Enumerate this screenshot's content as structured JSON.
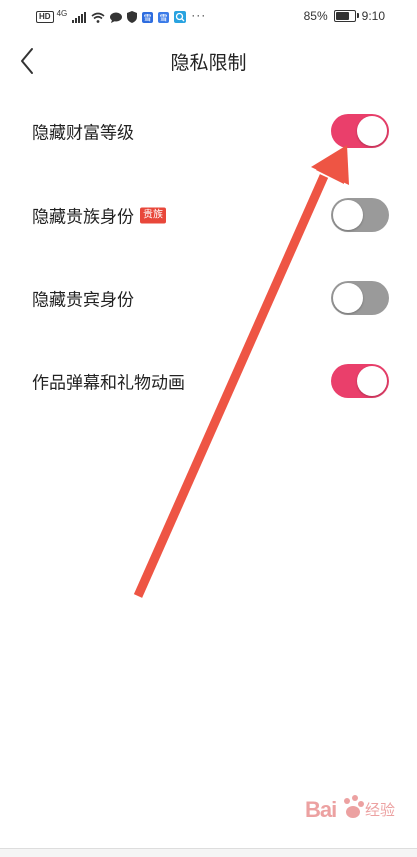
{
  "status_bar": {
    "hd": "HD",
    "signal_text": "4G",
    "overflow": "···",
    "battery_percent": "85%",
    "battery_level": 0.85,
    "time": "9:10"
  },
  "header": {
    "title": "隐私限制",
    "back_icon": "chevron-left-icon"
  },
  "settings": [
    {
      "label": "隐藏财富等级",
      "badge": "",
      "enabled": true
    },
    {
      "label": "隐藏贵族身份",
      "badge": "贵族",
      "enabled": false
    },
    {
      "label": "隐藏贵宾身份",
      "badge": "",
      "enabled": false
    },
    {
      "label": "作品弹幕和礼物动画",
      "badge": "",
      "enabled": true
    }
  ],
  "colors": {
    "toggle_on": "#ea3f6b",
    "toggle_off": "#9a9a9a",
    "arrow": "#ee5544",
    "badge": "#e8473a"
  },
  "watermark": {
    "text": "Bai",
    "sub": "经验"
  }
}
